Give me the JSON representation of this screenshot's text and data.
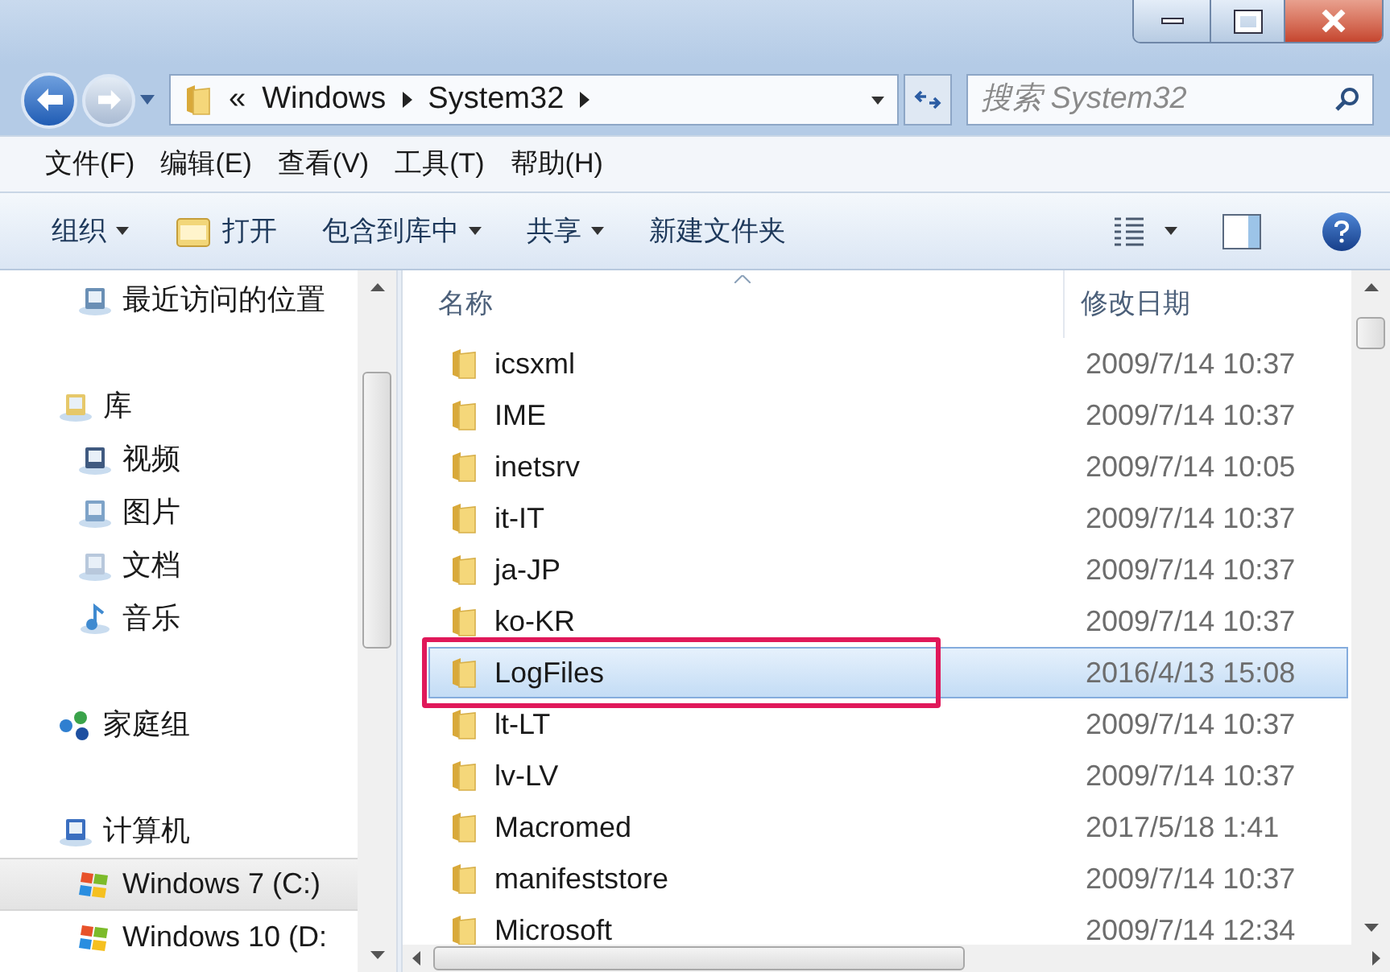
{
  "address": {
    "overflow": "«",
    "crumbs": [
      "Windows",
      "System32"
    ]
  },
  "search": {
    "placeholder": "搜索 System32"
  },
  "menu": [
    "文件(F)",
    "编辑(E)",
    "查看(V)",
    "工具(T)",
    "帮助(H)"
  ],
  "toolbar": [
    {
      "label": "组织",
      "kind": "dropdown"
    },
    {
      "label": "打开",
      "kind": "open"
    },
    {
      "label": "包含到库中",
      "kind": "dropdown"
    },
    {
      "label": "共享",
      "kind": "dropdown"
    },
    {
      "label": "新建文件夹",
      "kind": "plain"
    }
  ],
  "sidebar": {
    "groups": [
      {
        "items": [
          {
            "label": "最近访问的位置",
            "kind": "recent",
            "selected": false
          }
        ]
      },
      {
        "label": "库",
        "kind": "library",
        "items": [
          {
            "label": "视频",
            "kind": "video",
            "selected": false
          },
          {
            "label": "图片",
            "kind": "picture",
            "selected": false
          },
          {
            "label": "文档",
            "kind": "document",
            "selected": false
          },
          {
            "label": "音乐",
            "kind": "music",
            "selected": false
          }
        ]
      },
      {
        "label": "家庭组",
        "kind": "homegroup"
      },
      {
        "label": "计算机",
        "kind": "computer",
        "items": [
          {
            "label": "Windows 7 (C:)",
            "kind": "drive",
            "selected": true
          },
          {
            "label": "Windows 10 (D:",
            "kind": "drive",
            "selected": false
          }
        ]
      }
    ]
  },
  "table": {
    "columns": [
      "名称",
      "修改日期"
    ],
    "rows": [
      {
        "name": "icsxml",
        "date": "2009/7/14 10:37",
        "selected": false,
        "annotated": false
      },
      {
        "name": "IME",
        "date": "2009/7/14 10:37",
        "selected": false,
        "annotated": false
      },
      {
        "name": "inetsrv",
        "date": "2009/7/14 10:05",
        "selected": false,
        "annotated": false
      },
      {
        "name": "it-IT",
        "date": "2009/7/14 10:37",
        "selected": false,
        "annotated": false
      },
      {
        "name": "ja-JP",
        "date": "2009/7/14 10:37",
        "selected": false,
        "annotated": false
      },
      {
        "name": "ko-KR",
        "date": "2009/7/14 10:37",
        "selected": false,
        "annotated": false
      },
      {
        "name": "LogFiles",
        "date": "2016/4/13 15:08",
        "selected": true,
        "annotated": true
      },
      {
        "name": "lt-LT",
        "date": "2009/7/14 10:37",
        "selected": false,
        "annotated": false
      },
      {
        "name": "lv-LV",
        "date": "2009/7/14 10:37",
        "selected": false,
        "annotated": false
      },
      {
        "name": "Macromed",
        "date": "2017/5/18 1:41",
        "selected": false,
        "annotated": false
      },
      {
        "name": "manifeststore",
        "date": "2009/7/14 10:37",
        "selected": false,
        "annotated": false
      },
      {
        "name": "Microsoft",
        "date": "2009/7/14 12:34",
        "selected": false,
        "annotated": false
      }
    ]
  }
}
